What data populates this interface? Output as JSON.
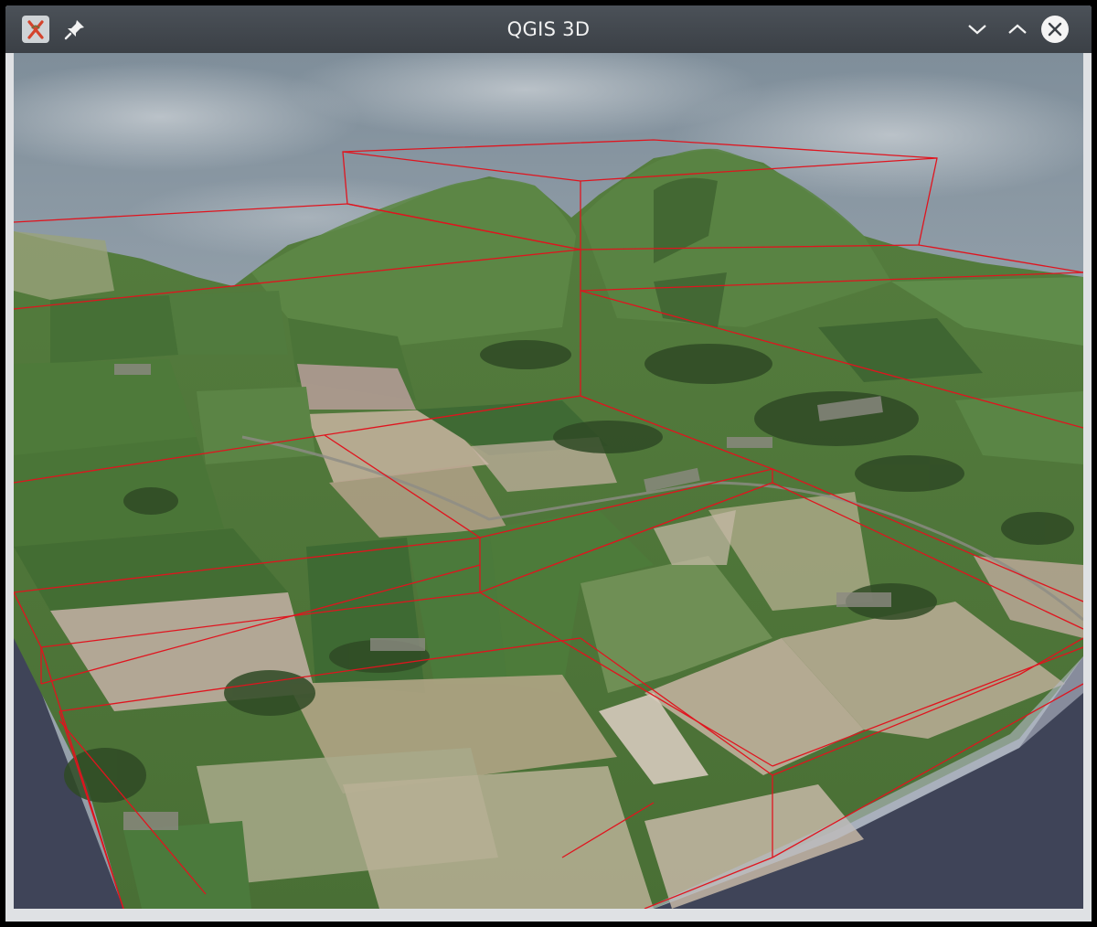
{
  "window": {
    "title": "QGIS 3D",
    "app_icon": "qgis-icon",
    "pin_icon": "pin-icon",
    "controls": {
      "minimize_icon": "chevron-down-icon",
      "maximize_icon": "chevron-up-icon",
      "close_icon": "close-icon"
    }
  },
  "scene": {
    "type": "3d-terrain-view",
    "bbox_color": "#e0141e",
    "sky_color": "#8f9aa5",
    "ground_color": "#4e7a3c",
    "background_color": "#3f4458"
  }
}
